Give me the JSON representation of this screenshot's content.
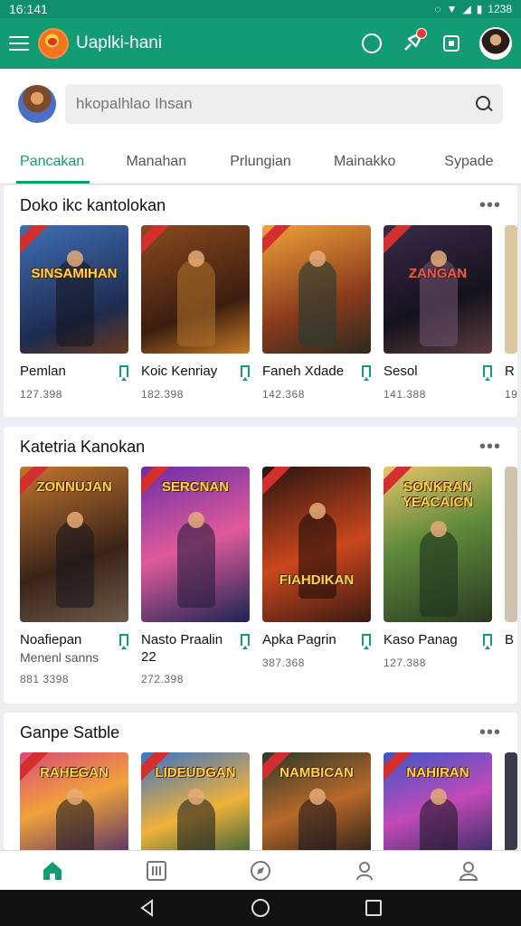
{
  "status": {
    "time": "16:141",
    "right": "1238"
  },
  "app": {
    "title": "Uaplki-hani"
  },
  "search": {
    "placeholder": "hkopalhlao Ihsan"
  },
  "tabs": [
    "Pancakan",
    "Manahan",
    "Prlungian",
    "Mainakko",
    "Sypade"
  ],
  "sections": [
    {
      "title": "Doko ikc kantolokan",
      "cards": [
        {
          "name": "Pemlan",
          "count": "127.398",
          "art": "SINSAMIHAN"
        },
        {
          "name": "Koic Kenriay",
          "count": "182.398",
          "art": ""
        },
        {
          "name": "Faneh Xdade",
          "count": "142.368",
          "art": ""
        },
        {
          "name": "Sesol",
          "count": "141.388",
          "art": "ZANGAN"
        },
        {
          "name": "R",
          "count": "19"
        }
      ]
    },
    {
      "title": "Katetria Kanokan",
      "cards": [
        {
          "name": "Noafiepan",
          "sub": "Menenl sanns",
          "count": "881 3398",
          "art": "ZONNUJAN"
        },
        {
          "name": "Nasto Praalin",
          "sub": "22",
          "count": "272.398",
          "art": "SERCNAN"
        },
        {
          "name": "Apka Pagrin",
          "count": "387.368",
          "art": "FIAHDIKAN"
        },
        {
          "name": "Kaso Panag",
          "count": "127.388",
          "art": "SONKRAN YEACAICN"
        },
        {
          "name": "B"
        }
      ]
    },
    {
      "title": "Ganpe Satble",
      "cards": [
        {
          "art": "RAHEGAN"
        },
        {
          "art": "LIDEUDGAN"
        },
        {
          "art": "NAMBICAN"
        },
        {
          "art": "NAHIRAN"
        },
        {
          "art": ""
        }
      ]
    }
  ],
  "icons": {
    "nav": [
      "home-icon",
      "grid-icon",
      "compass-icon",
      "community-icon",
      "profile-icon"
    ],
    "accent": "#139b74"
  }
}
